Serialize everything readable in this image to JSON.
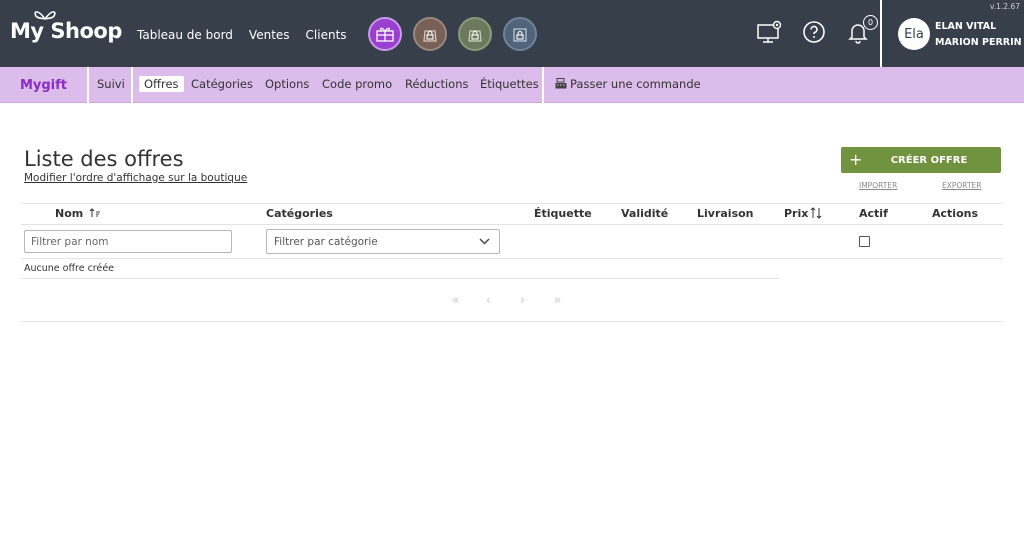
{
  "app": {
    "logo_text": "My Shoop",
    "version": "v.1.2.67"
  },
  "topnav": {
    "items": [
      "Tableau de bord",
      "Ventes",
      "Clients"
    ]
  },
  "shops": [
    {
      "icon": "gift-shop-icon",
      "color": "#9a3fcf"
    },
    {
      "icon": "locked-shop-icon",
      "color": "#776157"
    },
    {
      "icon": "locked-shop-icon",
      "color": "#6b7a5c"
    },
    {
      "icon": "locked-shop-icon",
      "color": "#4f6478"
    }
  ],
  "notifications": {
    "count": "0"
  },
  "user": {
    "initials": "Ela",
    "name_line1": "ELAN VITAL",
    "name_line2": "MARION PERRIN"
  },
  "subnav": {
    "brand": "Mygift",
    "items": [
      "Suivi",
      "Offres",
      "Catégories",
      "Options",
      "Code promo",
      "Réductions",
      "Étiquettes"
    ],
    "active": "Offres",
    "order_label": "Passer une commande"
  },
  "page": {
    "title": "Liste des offres",
    "reorder_link": "Modifier l'ordre d'affichage sur la boutique",
    "create_button": "CRÉER OFFRE",
    "import_link": "IMPORTER",
    "export_link": "EXPORTER"
  },
  "table": {
    "columns": [
      "Nom",
      "Catégories",
      "Étiquette",
      "Validité",
      "Livraison",
      "Prix",
      "Actif",
      "Actions"
    ],
    "filter_name_placeholder": "Filtrer par nom",
    "filter_category_placeholder": "Filtrer par catégorie",
    "empty_message": "Aucune offre créée"
  },
  "pagination": [
    "«",
    "‹",
    "›",
    "»"
  ],
  "colors": {
    "topbar": "#363f4a",
    "subnav": "#dcbcea",
    "brand": "#8a2bc4",
    "create_button": "#71923f"
  }
}
